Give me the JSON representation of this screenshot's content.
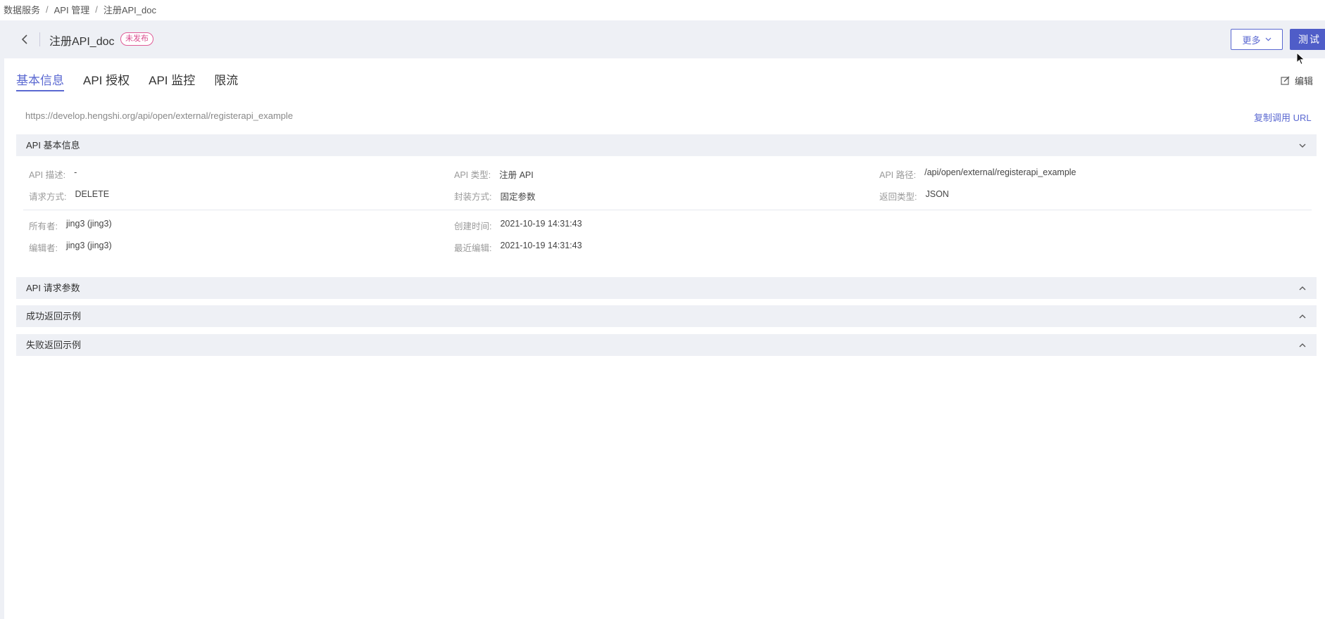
{
  "breadcrumb": {
    "items": [
      "数据服务",
      "API 管理",
      "注册API_doc"
    ],
    "separator": "/"
  },
  "header": {
    "title": "注册API_doc",
    "status": "未发布",
    "more_label": "更多",
    "test_label": "测试"
  },
  "tabs": [
    {
      "label": "基本信息",
      "active": true
    },
    {
      "label": "API 授权",
      "active": false
    },
    {
      "label": "API 监控",
      "active": false
    },
    {
      "label": "限流",
      "active": false
    }
  ],
  "edit_label": "编辑",
  "api_url": "https://develop.hengshi.org/api/open/external/registerapi_example",
  "copy_url_label": "复制调用 URL",
  "sections": {
    "basic_info": "API 基本信息",
    "request_params": "API 请求参数",
    "success_example": "成功返回示例",
    "failure_example": "失败返回示例"
  },
  "basic_info": {
    "description": {
      "label": "API 描述:",
      "value": "-"
    },
    "type": {
      "label": "API 类型:",
      "value": "注册 API"
    },
    "path": {
      "label": "API 路径:",
      "value": "/api/open/external/registerapi_example"
    },
    "method": {
      "label": "请求方式:",
      "value": "DELETE"
    },
    "packaging": {
      "label": "封装方式:",
      "value": "固定参数"
    },
    "return_type": {
      "label": "返回类型:",
      "value": "JSON"
    },
    "owner": {
      "label": "所有者:",
      "value": "jing3 (jing3)"
    },
    "created": {
      "label": "创建时间:",
      "value": "2021-10-19 14:31:43"
    },
    "editor": {
      "label": "编辑者:",
      "value": "jing3 (jing3)"
    },
    "last_edit": {
      "label": "最近编辑:",
      "value": "2021-10-19 14:31:43"
    }
  },
  "colors": {
    "accent": "#5a68d1",
    "header_bg": "#eef0f5",
    "badge": "#d94a8c"
  }
}
